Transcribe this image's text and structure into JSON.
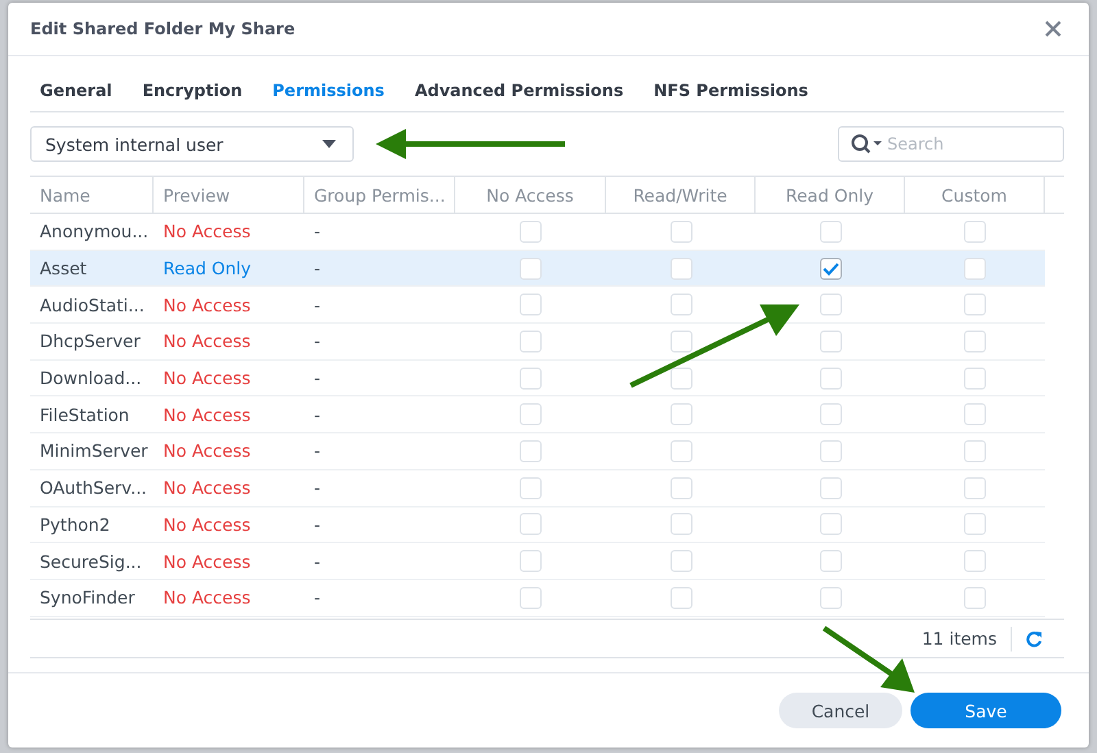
{
  "window": {
    "title": "Edit Shared Folder My Share"
  },
  "tabs": [
    {
      "label": "General",
      "selected": false
    },
    {
      "label": "Encryption",
      "selected": false
    },
    {
      "label": "Permissions",
      "selected": true
    },
    {
      "label": "Advanced Permissions",
      "selected": false
    },
    {
      "label": "NFS Permissions",
      "selected": false
    }
  ],
  "user_type_dropdown": {
    "value": "System internal user"
  },
  "search": {
    "placeholder": "Search"
  },
  "table": {
    "columns": [
      "Name",
      "Preview",
      "Group Permis...",
      "No Access",
      "Read/Write",
      "Read Only",
      "Custom"
    ],
    "rows": [
      {
        "name": "Anonymou...",
        "preview": "No Access",
        "group": "-",
        "selected": false,
        "permissions": [
          false,
          false,
          false,
          false
        ]
      },
      {
        "name": "Asset",
        "preview": "Read Only",
        "group": "-",
        "selected": true,
        "permissions": [
          false,
          false,
          true,
          false
        ]
      },
      {
        "name": "AudioStati...",
        "preview": "No Access",
        "group": "-",
        "selected": false,
        "permissions": [
          false,
          false,
          false,
          false
        ]
      },
      {
        "name": "DhcpServer",
        "preview": "No Access",
        "group": "-",
        "selected": false,
        "permissions": [
          false,
          false,
          false,
          false
        ]
      },
      {
        "name": "Download...",
        "preview": "No Access",
        "group": "-",
        "selected": false,
        "permissions": [
          false,
          false,
          false,
          false
        ]
      },
      {
        "name": "FileStation",
        "preview": "No Access",
        "group": "-",
        "selected": false,
        "permissions": [
          false,
          false,
          false,
          false
        ]
      },
      {
        "name": "MinimServer",
        "preview": "No Access",
        "group": "-",
        "selected": false,
        "permissions": [
          false,
          false,
          false,
          false
        ]
      },
      {
        "name": "OAuthServ...",
        "preview": "No Access",
        "group": "-",
        "selected": false,
        "permissions": [
          false,
          false,
          false,
          false
        ]
      },
      {
        "name": "Python2",
        "preview": "No Access",
        "group": "-",
        "selected": false,
        "permissions": [
          false,
          false,
          false,
          false
        ]
      },
      {
        "name": "SecureSig...",
        "preview": "No Access",
        "group": "-",
        "selected": false,
        "permissions": [
          false,
          false,
          false,
          false
        ]
      },
      {
        "name": "SynoFinder",
        "preview": "No Access",
        "group": "-",
        "selected": false,
        "permissions": [
          false,
          false,
          false,
          false
        ]
      }
    ],
    "item_count": "11 items"
  },
  "buttons": [
    {
      "label": "Cancel",
      "kind": "secondary"
    },
    {
      "label": "Save",
      "kind": "primary"
    }
  ]
}
